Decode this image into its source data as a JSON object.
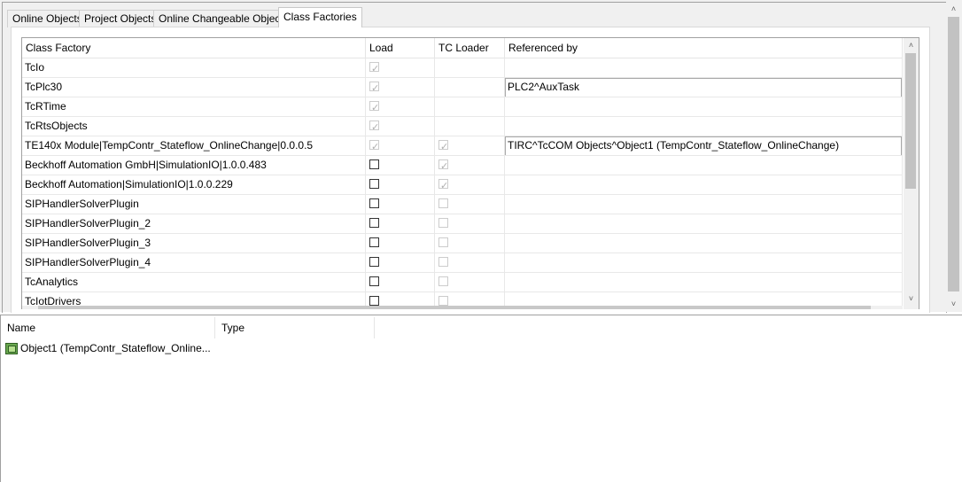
{
  "tabs": [
    {
      "label": "Online Objects",
      "active": false
    },
    {
      "label": "Project Objects",
      "active": false
    },
    {
      "label": "Online Changeable Objects",
      "active": false
    },
    {
      "label": "Class Factories",
      "active": true
    }
  ],
  "grid": {
    "columns": [
      "Class Factory",
      "Load",
      "TC Loader",
      "Referenced by"
    ],
    "rows": [
      {
        "name": "TcIo",
        "load": true,
        "load_enabled": false,
        "tc_loader": false,
        "tc_loader_enabled": false,
        "tc_loader_visible": false,
        "referenced_by": ""
      },
      {
        "name": "TcPlc30",
        "load": true,
        "load_enabled": false,
        "tc_loader": false,
        "tc_loader_enabled": false,
        "tc_loader_visible": false,
        "referenced_by": "PLC2^AuxTask"
      },
      {
        "name": "TcRTime",
        "load": true,
        "load_enabled": false,
        "tc_loader": false,
        "tc_loader_enabled": false,
        "tc_loader_visible": false,
        "referenced_by": ""
      },
      {
        "name": "TcRtsObjects",
        "load": true,
        "load_enabled": false,
        "tc_loader": false,
        "tc_loader_enabled": false,
        "tc_loader_visible": false,
        "referenced_by": ""
      },
      {
        "name": "TE140x Module|TempContr_Stateflow_OnlineChange|0.0.0.5",
        "load": true,
        "load_enabled": false,
        "tc_loader": true,
        "tc_loader_enabled": false,
        "tc_loader_visible": true,
        "referenced_by": "TIRC^TcCOM Objects^Object1 (TempContr_Stateflow_OnlineChange)"
      },
      {
        "name": "Beckhoff Automation GmbH|SimulationIO|1.0.0.483",
        "load": false,
        "load_enabled": true,
        "tc_loader": true,
        "tc_loader_enabled": false,
        "tc_loader_visible": true,
        "referenced_by": ""
      },
      {
        "name": "Beckhoff Automation|SimulationIO|1.0.0.229",
        "load": false,
        "load_enabled": true,
        "tc_loader": true,
        "tc_loader_enabled": false,
        "tc_loader_visible": true,
        "referenced_by": ""
      },
      {
        "name": "SIPHandlerSolverPlugin",
        "load": false,
        "load_enabled": true,
        "tc_loader": false,
        "tc_loader_enabled": false,
        "tc_loader_visible": true,
        "referenced_by": ""
      },
      {
        "name": "SIPHandlerSolverPlugin_2",
        "load": false,
        "load_enabled": true,
        "tc_loader": false,
        "tc_loader_enabled": false,
        "tc_loader_visible": true,
        "referenced_by": ""
      },
      {
        "name": "SIPHandlerSolverPlugin_3",
        "load": false,
        "load_enabled": true,
        "tc_loader": false,
        "tc_loader_enabled": false,
        "tc_loader_visible": true,
        "referenced_by": ""
      },
      {
        "name": "SIPHandlerSolverPlugin_4",
        "load": false,
        "load_enabled": true,
        "tc_loader": false,
        "tc_loader_enabled": false,
        "tc_loader_visible": true,
        "referenced_by": ""
      },
      {
        "name": "TcAnalytics",
        "load": false,
        "load_enabled": true,
        "tc_loader": false,
        "tc_loader_enabled": false,
        "tc_loader_visible": true,
        "referenced_by": ""
      },
      {
        "name": "TcIotDrivers",
        "load": false,
        "load_enabled": true,
        "tc_loader": false,
        "tc_loader_enabled": false,
        "tc_loader_visible": true,
        "referenced_by": ""
      }
    ]
  },
  "objects_list": {
    "columns": [
      "Name",
      "Type"
    ],
    "items": [
      {
        "name": "Object1 (TempContr_Stateflow_Online...",
        "type": "",
        "icon": "tccom-object-icon"
      }
    ]
  },
  "scroll": {
    "up_glyph": "˄",
    "down_glyph": "˅"
  },
  "check_glyph": "✓"
}
